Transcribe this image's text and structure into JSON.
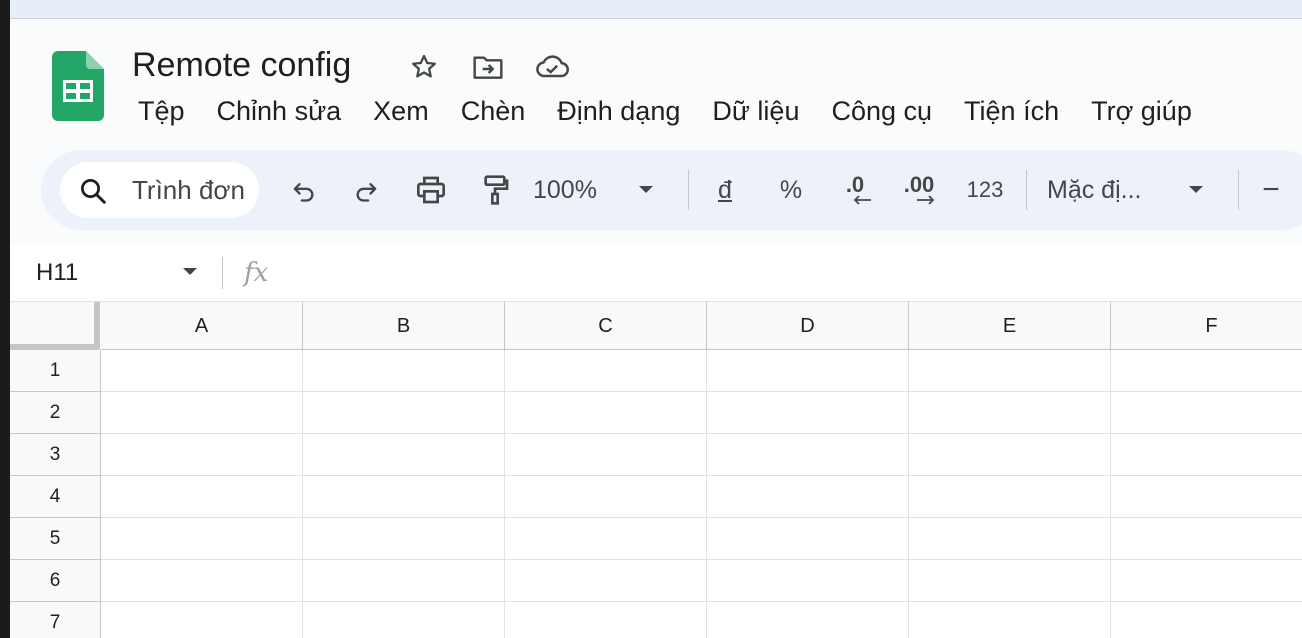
{
  "document": {
    "title": "Remote config",
    "logo_icon": "google-sheets-logo",
    "title_icons": [
      "star-icon",
      "move-to-folder-icon",
      "cloud-saved-icon"
    ]
  },
  "menu": {
    "items": [
      "Tệp",
      "Chỉnh sửa",
      "Xem",
      "Chèn",
      "Định dạng",
      "Dữ liệu",
      "Công cụ",
      "Tiện ích",
      "Trợ giúp"
    ]
  },
  "toolbar": {
    "search_text": "Trình đơn",
    "undo_icon": "undo-icon",
    "redo_icon": "redo-icon",
    "print_icon": "print-icon",
    "paint_format_icon": "paint-format-icon",
    "zoom": "100%",
    "currency": "đ",
    "percent": "%",
    "decrease_decimal": ".0",
    "increase_decimal": ".00",
    "number_format": "123",
    "font": "Mặc đị...",
    "font_size_minus": "−"
  },
  "formula_bar": {
    "cell_ref": "H11",
    "fx_label": "fx",
    "value": ""
  },
  "sheet": {
    "columns": [
      "A",
      "B",
      "C",
      "D",
      "E",
      "F"
    ],
    "rows": [
      "1",
      "2",
      "3",
      "4",
      "5",
      "6",
      "7"
    ]
  },
  "colors": {
    "sheets_green": "#23a566",
    "toolbar_bg": "#edf2fa",
    "app_bg": "#f9fbfd",
    "header_bg": "#f8f9fa"
  }
}
